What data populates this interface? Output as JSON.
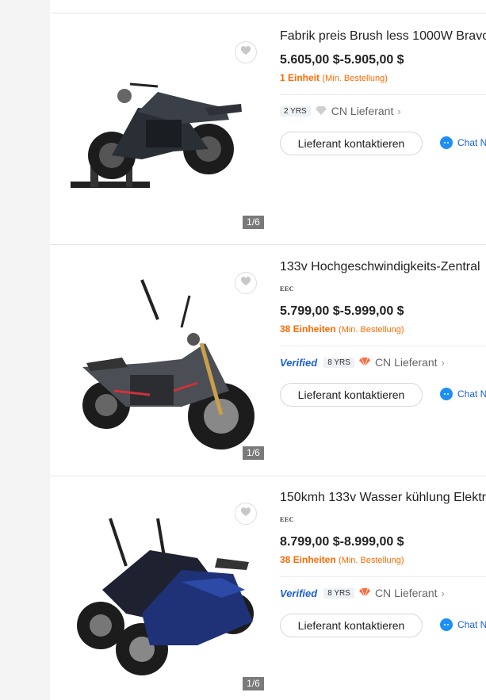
{
  "products": [
    {
      "title": "Fabrik preis Brush less 1000W Bravo",
      "eec": "",
      "price": "5.605,00 $-5.905,00 $",
      "moq_qty": "1 Einheit",
      "moq_suffix": "(Min. Bestellung)",
      "verified": "",
      "years": "2 YRS",
      "country": "CN",
      "supplier_type": "Lieferant",
      "contact_label": "Lieferant kontaktieren",
      "chat_label": "Chat N",
      "image_count": "1/6",
      "image_icon": "black-electric-motorcycle-on-stand"
    },
    {
      "title": "133v Hochgeschwindigkeits-Zentral",
      "eec": "EEC",
      "price": "5.799,00 $-5.999,00 $",
      "moq_qty": "38 Einheiten",
      "moq_suffix": "(Min. Bestellung)",
      "verified": "Verified",
      "years": "8 YRS",
      "country": "CN",
      "supplier_type": "Lieferant",
      "contact_label": "Lieferant kontaktieren",
      "chat_label": "Chat N",
      "image_count": "1/6",
      "image_icon": "gray-electric-motorcycle"
    },
    {
      "title": "150kmh 133v Wasser kühlung Elektr",
      "eec": "EEC",
      "price": "8.799,00 $-8.999,00 $",
      "moq_qty": "38 Einheiten",
      "moq_suffix": "(Min. Bestellung)",
      "verified": "Verified",
      "years": "8 YRS",
      "country": "CN",
      "supplier_type": "Lieferant",
      "contact_label": "Lieferant kontaktieren",
      "chat_label": "Chat N",
      "image_count": "1/6",
      "image_icon": "two-blue-electric-motorcycles"
    }
  ],
  "colors": {
    "accent_orange": "#ff6a00",
    "verified_blue": "#1a5fd8",
    "chat_blue": "#1d8ff5"
  }
}
